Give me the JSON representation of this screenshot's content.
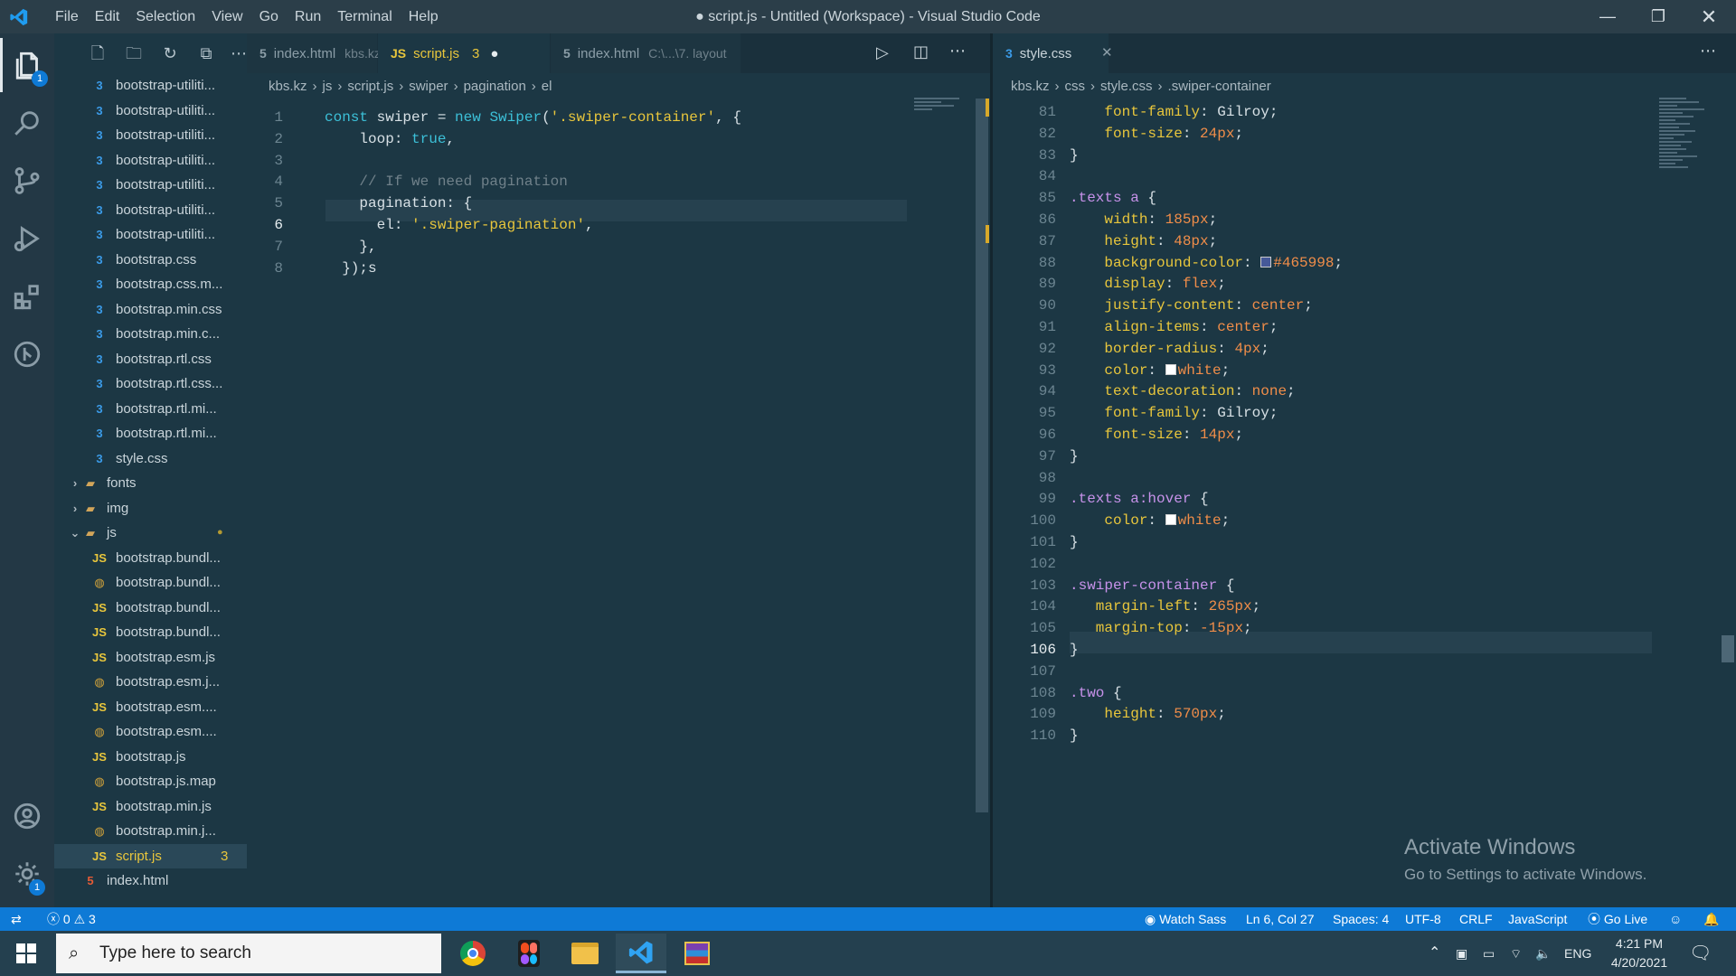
{
  "window": {
    "title": "● script.js - Untitled (Workspace) - Visual Studio Code",
    "menu": [
      "File",
      "Edit",
      "Selection",
      "View",
      "Go",
      "Run",
      "Terminal",
      "Help"
    ]
  },
  "activity": {
    "explorer_badge": "1",
    "settings_badge": "1"
  },
  "explorer": {
    "items": [
      {
        "label": "bootstrap-utiliti...",
        "icon": "css",
        "indent": 1
      },
      {
        "label": "bootstrap-utiliti...",
        "icon": "css",
        "indent": 1
      },
      {
        "label": "bootstrap-utiliti...",
        "icon": "css",
        "indent": 1
      },
      {
        "label": "bootstrap-utiliti...",
        "icon": "css",
        "indent": 1
      },
      {
        "label": "bootstrap-utiliti...",
        "icon": "css",
        "indent": 1
      },
      {
        "label": "bootstrap-utiliti...",
        "icon": "css",
        "indent": 1
      },
      {
        "label": "bootstrap-utiliti...",
        "icon": "css",
        "indent": 1
      },
      {
        "label": "bootstrap.css",
        "icon": "css",
        "indent": 1
      },
      {
        "label": "bootstrap.css.m...",
        "icon": "css",
        "indent": 1
      },
      {
        "label": "bootstrap.min.css",
        "icon": "css",
        "indent": 1
      },
      {
        "label": "bootstrap.min.c...",
        "icon": "css",
        "indent": 1
      },
      {
        "label": "bootstrap.rtl.css",
        "icon": "css",
        "indent": 1
      },
      {
        "label": "bootstrap.rtl.css...",
        "icon": "css",
        "indent": 1
      },
      {
        "label": "bootstrap.rtl.mi...",
        "icon": "css",
        "indent": 1
      },
      {
        "label": "bootstrap.rtl.mi...",
        "icon": "css",
        "indent": 1
      },
      {
        "label": "style.css",
        "icon": "css",
        "indent": 1
      },
      {
        "label": "fonts",
        "icon": "folder",
        "indent": 0,
        "chevron": "›"
      },
      {
        "label": "img",
        "icon": "folder",
        "indent": 0,
        "chevron": "›"
      },
      {
        "label": "js",
        "icon": "folder",
        "indent": 0,
        "chevron": "⌄",
        "modified": true
      },
      {
        "label": "bootstrap.bundl...",
        "icon": "js",
        "indent": 1
      },
      {
        "label": "bootstrap.bundl...",
        "icon": "map",
        "indent": 1
      },
      {
        "label": "bootstrap.bundl...",
        "icon": "js",
        "indent": 1
      },
      {
        "label": "bootstrap.bundl...",
        "icon": "js",
        "indent": 1
      },
      {
        "label": "bootstrap.esm.js",
        "icon": "js",
        "indent": 1
      },
      {
        "label": "bootstrap.esm.j...",
        "icon": "map",
        "indent": 1
      },
      {
        "label": "bootstrap.esm....",
        "icon": "js",
        "indent": 1
      },
      {
        "label": "bootstrap.esm....",
        "icon": "map",
        "indent": 1
      },
      {
        "label": "bootstrap.js",
        "icon": "js",
        "indent": 1
      },
      {
        "label": "bootstrap.js.map",
        "icon": "map",
        "indent": 1
      },
      {
        "label": "bootstrap.min.js",
        "icon": "js",
        "indent": 1
      },
      {
        "label": "bootstrap.min.j...",
        "icon": "map",
        "indent": 1
      },
      {
        "label": "script.js",
        "icon": "js",
        "indent": 1,
        "selected": true,
        "count": "3"
      },
      {
        "label": "index.html",
        "icon": "html",
        "indent": 0
      }
    ]
  },
  "left_editor": {
    "tabs": [
      {
        "label": "index.html",
        "desc": "kbs.kz",
        "icon": "html"
      },
      {
        "label": "script.js",
        "count": "3",
        "icon": "js",
        "active": true,
        "dirty": true
      },
      {
        "label": "index.html",
        "desc": "C:\\...\\7. layout",
        "icon": "html"
      }
    ],
    "breadcrumb": [
      "kbs.kz",
      "js",
      "script.js",
      "swiper",
      "pagination",
      "el"
    ],
    "lines": [
      {
        "n": "1",
        "tokens": [
          [
            "kw",
            "const"
          ],
          [
            "punc",
            " swiper = "
          ],
          [
            "kw",
            "new"
          ],
          [
            "punc",
            " "
          ],
          [
            "kw",
            "Swiper"
          ],
          [
            "punc",
            "("
          ],
          [
            "str",
            "'.swiper-container'"
          ],
          [
            "punc",
            ", {"
          ]
        ]
      },
      {
        "n": "2",
        "tokens": [
          [
            "punc",
            "    loop: "
          ],
          [
            "kw",
            "true"
          ],
          [
            "punc",
            ","
          ]
        ]
      },
      {
        "n": "3",
        "tokens": [
          [
            "punc",
            ""
          ]
        ]
      },
      {
        "n": "4",
        "tokens": [
          [
            "cmt",
            "    // If we need pagination"
          ]
        ]
      },
      {
        "n": "5",
        "tokens": [
          [
            "punc",
            "    pagination: {"
          ]
        ]
      },
      {
        "n": "6",
        "tokens": [
          [
            "punc",
            "      el: "
          ],
          [
            "str",
            "'.swiper-pagination'"
          ],
          [
            "punc",
            ","
          ]
        ]
      },
      {
        "n": "7",
        "tokens": [
          [
            "punc",
            "    },"
          ]
        ]
      },
      {
        "n": "8",
        "tokens": [
          [
            "punc",
            "  });s"
          ]
        ]
      }
    ]
  },
  "right_editor": {
    "tab": {
      "label": "style.css",
      "icon": "css"
    },
    "breadcrumb": [
      "kbs.kz",
      "css",
      "style.css",
      ".swiper-container"
    ],
    "lines": [
      {
        "n": "81",
        "tokens": [
          [
            "prop",
            "    font-family"
          ],
          [
            "punc",
            ": Gilroy;"
          ]
        ]
      },
      {
        "n": "82",
        "tokens": [
          [
            "prop",
            "    font-size"
          ],
          [
            "punc",
            ": "
          ],
          [
            "val",
            "24px"
          ],
          [
            "punc",
            ";"
          ]
        ]
      },
      {
        "n": "83",
        "tokens": [
          [
            "punc",
            "}"
          ]
        ]
      },
      {
        "n": "84",
        "tokens": [
          [
            "punc",
            ""
          ]
        ]
      },
      {
        "n": "85",
        "tokens": [
          [
            "sel-c",
            ".texts a"
          ],
          [
            "punc",
            " {"
          ]
        ]
      },
      {
        "n": "86",
        "tokens": [
          [
            "prop",
            "    width"
          ],
          [
            "punc",
            ": "
          ],
          [
            "val",
            "185px"
          ],
          [
            "punc",
            ";"
          ]
        ]
      },
      {
        "n": "87",
        "tokens": [
          [
            "prop",
            "    height"
          ],
          [
            "punc",
            ": "
          ],
          [
            "val",
            "48px"
          ],
          [
            "punc",
            ";"
          ]
        ]
      },
      {
        "n": "88",
        "tokens": [
          [
            "prop",
            "    background-color"
          ],
          [
            "punc",
            ": "
          ],
          [
            "swatch",
            "#465998"
          ],
          [
            "val",
            "#465998"
          ],
          [
            "punc",
            ";"
          ]
        ]
      },
      {
        "n": "89",
        "tokens": [
          [
            "prop",
            "    display"
          ],
          [
            "punc",
            ": "
          ],
          [
            "val",
            "flex"
          ],
          [
            "punc",
            ";"
          ]
        ]
      },
      {
        "n": "90",
        "tokens": [
          [
            "prop",
            "    justify-content"
          ],
          [
            "punc",
            ": "
          ],
          [
            "val",
            "center"
          ],
          [
            "punc",
            ";"
          ]
        ]
      },
      {
        "n": "91",
        "tokens": [
          [
            "prop",
            "    align-items"
          ],
          [
            "punc",
            ": "
          ],
          [
            "val",
            "center"
          ],
          [
            "punc",
            ";"
          ]
        ]
      },
      {
        "n": "92",
        "tokens": [
          [
            "prop",
            "    border-radius"
          ],
          [
            "punc",
            ": "
          ],
          [
            "val",
            "4px"
          ],
          [
            "punc",
            ";"
          ]
        ]
      },
      {
        "n": "93",
        "tokens": [
          [
            "prop",
            "    color"
          ],
          [
            "punc",
            ": "
          ],
          [
            "swatch",
            "#ffffff"
          ],
          [
            "val",
            "white"
          ],
          [
            "punc",
            ";"
          ]
        ]
      },
      {
        "n": "94",
        "tokens": [
          [
            "prop",
            "    text-decoration"
          ],
          [
            "punc",
            ": "
          ],
          [
            "val",
            "none"
          ],
          [
            "punc",
            ";"
          ]
        ]
      },
      {
        "n": "95",
        "tokens": [
          [
            "prop",
            "    font-family"
          ],
          [
            "punc",
            ": Gilroy;"
          ]
        ]
      },
      {
        "n": "96",
        "tokens": [
          [
            "prop",
            "    font-size"
          ],
          [
            "punc",
            ": "
          ],
          [
            "val",
            "14px"
          ],
          [
            "punc",
            ";"
          ]
        ]
      },
      {
        "n": "97",
        "tokens": [
          [
            "punc",
            "}"
          ]
        ]
      },
      {
        "n": "98",
        "tokens": [
          [
            "punc",
            ""
          ]
        ]
      },
      {
        "n": "99",
        "tokens": [
          [
            "sel-c",
            ".texts a:hover"
          ],
          [
            "punc",
            " {"
          ]
        ]
      },
      {
        "n": "100",
        "tokens": [
          [
            "prop",
            "    color"
          ],
          [
            "punc",
            ": "
          ],
          [
            "swatch",
            "#ffffff"
          ],
          [
            "val",
            "white"
          ],
          [
            "punc",
            ";"
          ]
        ]
      },
      {
        "n": "101",
        "tokens": [
          [
            "punc",
            "}"
          ]
        ]
      },
      {
        "n": "102",
        "tokens": [
          [
            "punc",
            ""
          ]
        ]
      },
      {
        "n": "103",
        "tokens": [
          [
            "sel-c",
            ".swiper-container"
          ],
          [
            "punc",
            " {"
          ]
        ]
      },
      {
        "n": "104",
        "tokens": [
          [
            "prop",
            "   margin-left"
          ],
          [
            "punc",
            ": "
          ],
          [
            "val",
            "265px"
          ],
          [
            "punc",
            ";"
          ]
        ]
      },
      {
        "n": "105",
        "tokens": [
          [
            "prop",
            "   margin-top"
          ],
          [
            "punc",
            ": "
          ],
          [
            "val",
            "-15px"
          ],
          [
            "punc",
            ";"
          ]
        ]
      },
      {
        "n": "106",
        "tokens": [
          [
            "punc",
            "}"
          ]
        ]
      },
      {
        "n": "107",
        "tokens": [
          [
            "punc",
            ""
          ]
        ]
      },
      {
        "n": "108",
        "tokens": [
          [
            "sel-c",
            ".two"
          ],
          [
            "punc",
            " {"
          ]
        ]
      },
      {
        "n": "109",
        "tokens": [
          [
            "prop",
            "    height"
          ],
          [
            "punc",
            ": "
          ],
          [
            "val",
            "570px"
          ],
          [
            "punc",
            ";"
          ]
        ]
      },
      {
        "n": "110",
        "tokens": [
          [
            "punc",
            "}"
          ]
        ]
      }
    ]
  },
  "status": {
    "errors": "0",
    "warnings": "3",
    "watch": "Watch Sass",
    "position": "Ln 6, Col 27",
    "spaces": "Spaces: 4",
    "encoding": "UTF-8",
    "eol": "CRLF",
    "language": "JavaScript",
    "golive": "Go Live"
  },
  "watermark": {
    "line1": "Activate Windows",
    "line2": "Go to Settings to activate Windows."
  },
  "taskbar": {
    "search_placeholder": "Type here to search",
    "lang": "ENG",
    "time": "4:21 PM",
    "date": "4/20/2021"
  }
}
